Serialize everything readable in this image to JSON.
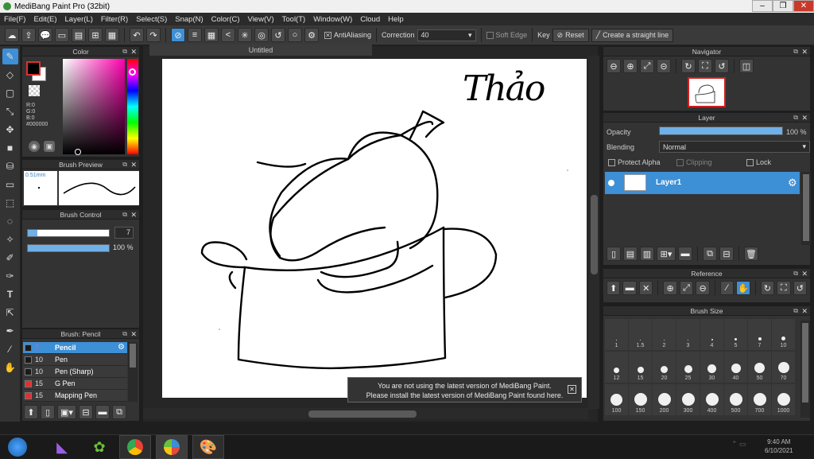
{
  "window": {
    "title": "MediBang Paint Pro (32bit)"
  },
  "menu": [
    "File(F)",
    "Edit(E)",
    "Layer(L)",
    "Filter(R)",
    "Select(S)",
    "Snap(N)",
    "Color(C)",
    "View(V)",
    "Tool(T)",
    "Window(W)",
    "Cloud",
    "Help"
  ],
  "toolbar": {
    "antialiasing_label": "AntiAliasing",
    "correction_label": "Correction",
    "correction_value": "40",
    "soft_edge_label": "Soft Edge",
    "key_label": "Key",
    "reset_label": "Reset",
    "straight_line_label": "Create a straight line"
  },
  "color_panel": {
    "title": "Color",
    "r": "R:0",
    "g": "G:0",
    "b": "B:0",
    "hex": "#000000",
    "foreground": "#000000",
    "background": "#ffffff",
    "accent": "#3d8fd6"
  },
  "brush_preview": {
    "title": "Brush Preview",
    "size": "0.51mm"
  },
  "brush_control": {
    "title": "Brush Control",
    "size_value": "7",
    "opacity_value": "100 %",
    "size_fraction": 0.07,
    "opacity_fraction": 1.0
  },
  "brush_list": {
    "title": "Brush: Pencil",
    "items": [
      {
        "size": "7",
        "name": "Pencil",
        "color": "#1a1a1a",
        "selected": true
      },
      {
        "size": "10",
        "name": "Pen",
        "color": "#1a1a1a",
        "selected": false
      },
      {
        "size": "10",
        "name": "Pen (Sharp)",
        "color": "#1a1a1a",
        "selected": false
      },
      {
        "size": "15",
        "name": "G Pen",
        "color": "#e03030",
        "selected": false
      },
      {
        "size": "15",
        "name": "Mapping Pen",
        "color": "#e03030",
        "selected": false
      }
    ]
  },
  "canvas": {
    "tab": "Untitled",
    "signature": "Thảo"
  },
  "notice": {
    "line1": "You are not using the latest version of MediBang Paint.",
    "line2": "Please install the latest version of MediBang Paint found here."
  },
  "navigator": {
    "title": "Navigator"
  },
  "layer_panel": {
    "title": "Layer",
    "opacity_label": "Opacity",
    "opacity_value": "100 %",
    "opacity_fraction": 1.0,
    "blending_label": "Blending",
    "blending_value": "Normal",
    "protect_alpha": "Protect Alpha",
    "clipping": "Clipping",
    "lock": "Lock",
    "layers": [
      {
        "name": "Layer1"
      }
    ]
  },
  "reference": {
    "title": "Reference"
  },
  "brush_size": {
    "title": "Brush Size",
    "row1": [
      "1",
      "1.5",
      "2",
      "3",
      "4",
      "5",
      "7",
      "10"
    ],
    "row2": [
      "12",
      "15",
      "20",
      "25",
      "30",
      "40",
      "50",
      "70"
    ],
    "row3": [
      "100",
      "150",
      "200",
      "300",
      "400",
      "500",
      "700",
      "1000"
    ]
  },
  "taskbar": {
    "time": "9:40 AM",
    "date": "6/10/2021"
  }
}
